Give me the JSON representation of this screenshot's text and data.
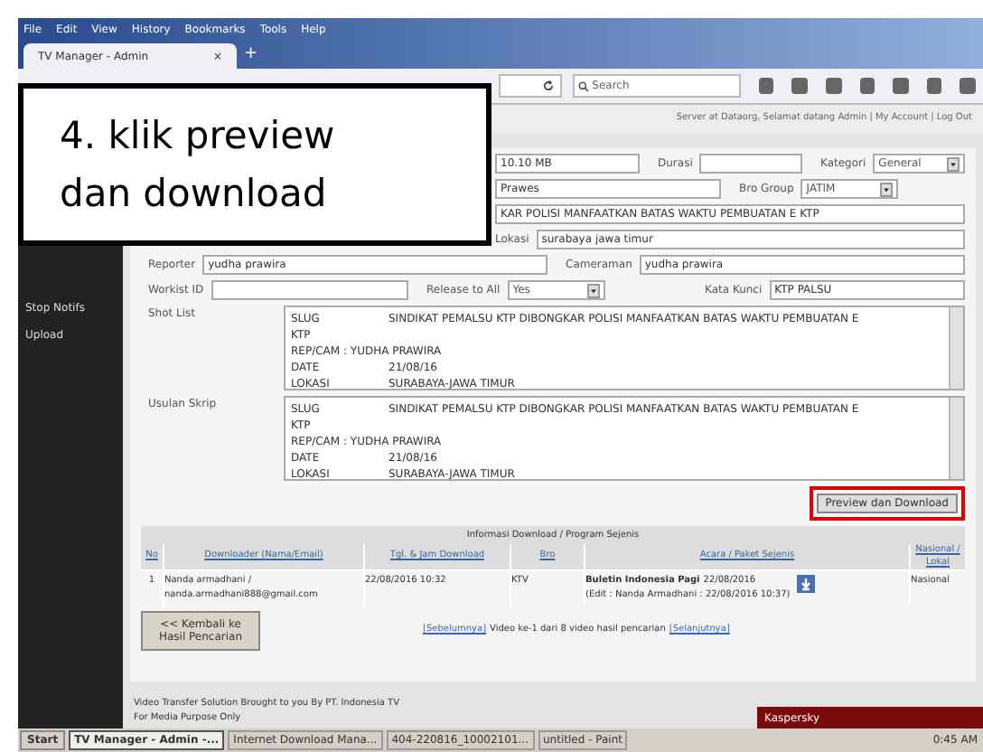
{
  "menu": [
    "File",
    "Edit",
    "View",
    "History",
    "Bookmarks",
    "Tools",
    "Help"
  ],
  "tab": {
    "title": "TV Manager - Admin",
    "close": "×",
    "new": "+"
  },
  "search": {
    "placeholder": "Search"
  },
  "header_links": "Server at Dataorg, Selamat datang Admin | My Account | Log Out",
  "callout": "4. klik preview dan download",
  "sidebar": {
    "items": [
      "Stop Notifs",
      "Upload"
    ]
  },
  "form": {
    "rows": [
      {
        "fields": [
          {
            "value": "10.10 MB",
            "kind": "input"
          },
          {
            "label": "Durasi",
            "kind": "input"
          },
          {
            "label": "Kategori",
            "value": "General",
            "kind": "select"
          }
        ]
      },
      {
        "fields": [
          {
            "value": "Prawes",
            "kind": "input"
          },
          {
            "label": "Bro Group",
            "value": "JATIM",
            "kind": "select"
          }
        ]
      },
      {
        "fields": [
          {
            "value": "KAR POLISI MANFAATKAN BATAS WAKTU PEMBUATAN E KTP",
            "kind": "input"
          }
        ]
      },
      {
        "fields": [
          {
            "label": "Lokasi",
            "value": "surabaya jawa timur",
            "kind": "input"
          }
        ]
      },
      {
        "fields": [
          {
            "label": "Reporter",
            "value": "yudha prawira",
            "kind": "input"
          },
          {
            "label": "Cameraman",
            "value": "yudha prawira",
            "kind": "input"
          }
        ]
      },
      {
        "fields": [
          {
            "label": "Workist ID",
            "kind": "input"
          },
          {
            "label": "Release to All",
            "value": "Yes",
            "kind": "select"
          },
          {
            "label": "Kata Kunci",
            "value": "KTP PALSU",
            "kind": "input"
          }
        ]
      }
    ],
    "textareas": [
      {
        "label": "Shot List",
        "lines": [
          [
            "SLUG",
            "SINDIKAT PEMALSU KTP DIBONGKAR POLISI MANFAATKAN BATAS WAKTU PEMBUATAN E"
          ],
          [
            "KTP"
          ],
          [
            "REP/CAM : YUDHA PRAWIRA"
          ],
          [
            "DATE",
            "21/08/16"
          ],
          [
            "LOKASI",
            "SURABAYA-JAWA TIMUR"
          ]
        ]
      },
      {
        "label": "Usulan Skrip",
        "lines": [
          [
            "SLUG",
            "SINDIKAT PEMALSU KTP DIBONGKAR POLISI MANFAATKAN BATAS WAKTU PEMBUATAN E"
          ],
          [
            "KTP"
          ],
          [
            "REP/CAM : YUDHA PRAWIRA"
          ],
          [
            "DATE",
            "21/08/16"
          ],
          [
            "LOKASI",
            "SURABAYA-JAWA TIMUR"
          ]
        ]
      }
    ],
    "preview_button": {
      "label": "Preview dan Download",
      "highlighted": true
    }
  },
  "table": {
    "title": "Informasi Download / Program Sejenis",
    "columns": [
      "No",
      "Downloader (Nama/Email)",
      "Tgl. & Jam Download",
      "Bro",
      "Acara / Paket Sejenis",
      "Nasional / Lokal"
    ],
    "rows": [
      {
        "no": "1",
        "downloader": "Nanda armadhani /",
        "email": "nanda.armadhani888@gmail.com",
        "time": "22/08/2016 10:32",
        "bro": "KTV",
        "program": "Buletin Indonesia Pagi",
        "program_date": "22/08/2016",
        "edit": "(Edit : Nanda Armadhani : 22/08/2016 10:37)",
        "scope": "Nasional"
      }
    ]
  },
  "back_button": "<< Kembali ke Hasil Pencarian",
  "pagination": {
    "prev": "[Sebelumnya]",
    "text": "Video ke-1 dari 8 video hasil pencarian",
    "next": "[Selanjutnya]"
  },
  "footer": [
    "Video Transfer Solution Brought to you By PT. Indonesia TV",
    "For Media Purpose Only"
  ],
  "popup": "Kaspersky",
  "taskbar": {
    "start": "Start",
    "items": [
      {
        "label": "TV Manager - Admin -...",
        "selected": true
      },
      {
        "label": "Internet Download Mana...",
        "selected": false
      },
      {
        "label": "404-220816_10002101...",
        "selected": false
      },
      {
        "label": "untitled - Paint",
        "selected": false
      }
    ],
    "clock": "0:45 AM"
  }
}
